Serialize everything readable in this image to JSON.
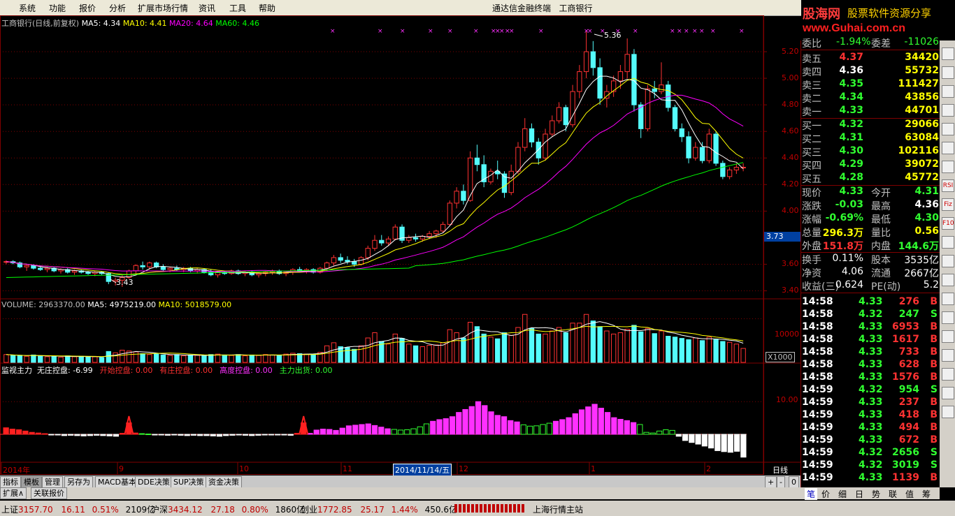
{
  "menu": [
    "系统",
    "功能",
    "报价",
    "分析",
    "扩展市场行情",
    "资讯",
    "工具",
    "帮助"
  ],
  "app_title": "通达信金融终端",
  "stock_name_title": "工商银行",
  "logo": {
    "name": "股海网",
    "slogan": "股票软件资源分享",
    "url": "www.Guhai.com.cn"
  },
  "main_legend": {
    "title": "工商银行(日线,前复权)",
    "ma5": "MA5: 4.34",
    "ma10": "MA10: 4.41",
    "ma20": "MA20: 4.64",
    "ma60": "MA60: 4.46"
  },
  "price_axis": {
    "ticks": [
      "5.20",
      "5.00",
      "4.80",
      "4.60",
      "4.40",
      "4.20",
      "4.00",
      "3.73",
      "3.60",
      "3.40"
    ],
    "current": "3.73"
  },
  "annotations": {
    "high": "5.36",
    "low": "3.43"
  },
  "volume_legend": {
    "volume": "VOLUME: 2963370.00",
    "ma5": "MA5: 4975219.00",
    "ma10": "MA10: 5018579.00",
    "axis_tick": "10000",
    "unit": "X1000"
  },
  "indicator_legend": {
    "name": "监视主力",
    "items": [
      {
        "label": "无庄控盘: -6.99",
        "color": "#ffffff"
      },
      {
        "label": "开始控盘: 0.00",
        "color": "#ff3030"
      },
      {
        "label": "有庄控盘: 0.00",
        "color": "#ff3030"
      },
      {
        "label": "高度控盘: 0.00",
        "color": "#ff30ff"
      },
      {
        "label": "主力出货: 0.00",
        "color": "#30ff30"
      }
    ],
    "axis_tick": "10.00"
  },
  "time_axis": {
    "labels": [
      "2014年",
      "9",
      "10",
      "11",
      "2014/11/14/五",
      "12",
      "1",
      "2"
    ],
    "period": "日线"
  },
  "tabs": [
    "指标",
    "模板",
    "管理",
    "另存为",
    "MACD基本",
    "DDE决策",
    "SUP决策",
    "资金决策"
  ],
  "sub_tabs": [
    "扩展∧",
    "关联报价"
  ],
  "zoom_controls": [
    "+",
    "-",
    "0"
  ],
  "quote_panel": {
    "ratio": {
      "label": "委比",
      "value": "-1.94%",
      "diff_label": "委差",
      "diff": "-11026"
    },
    "asks": [
      {
        "label": "卖五",
        "price": "4.37",
        "vol": "34420"
      },
      {
        "label": "卖四",
        "price": "4.36",
        "vol": "55732"
      },
      {
        "label": "卖三",
        "price": "4.35",
        "vol": "111427"
      },
      {
        "label": "卖二",
        "price": "4.34",
        "vol": "43856"
      },
      {
        "label": "卖一",
        "price": "4.33",
        "vol": "44701"
      }
    ],
    "bids": [
      {
        "label": "买一",
        "price": "4.32",
        "vol": "29066"
      },
      {
        "label": "买二",
        "price": "4.31",
        "vol": "63084"
      },
      {
        "label": "买三",
        "price": "4.30",
        "vol": "102116"
      },
      {
        "label": "买四",
        "price": "4.29",
        "vol": "39072"
      },
      {
        "label": "买五",
        "price": "4.28",
        "vol": "45772"
      }
    ],
    "stats": [
      {
        "l1": "现价",
        "v1": "4.33",
        "l2": "今开",
        "v2": "4.31"
      },
      {
        "l1": "涨跌",
        "v1": "-0.03",
        "l2": "最高",
        "v2": "4.36"
      },
      {
        "l1": "涨幅",
        "v1": "-0.69%",
        "l2": "最低",
        "v2": "4.30"
      },
      {
        "l1": "总量",
        "v1": "296.3万",
        "l2": "量比",
        "v2": "0.56"
      },
      {
        "l1": "外盘",
        "v1": "151.8万",
        "l2": "内盘",
        "v2": "144.6万"
      }
    ],
    "fundamentals": [
      {
        "l1": "换手",
        "v1": "0.11%",
        "l2": "股本",
        "v2": "3535亿"
      },
      {
        "l1": "净资",
        "v1": "4.06",
        "l2": "流通",
        "v2": "2667亿"
      },
      {
        "l1": "收益(三)",
        "v1": "0.624",
        "l2": "PE(动)",
        "v2": "5.2"
      }
    ],
    "ticks": [
      {
        "t": "14:58",
        "p": "4.33",
        "v": "276",
        "s": "B"
      },
      {
        "t": "14:58",
        "p": "4.32",
        "v": "247",
        "s": "S"
      },
      {
        "t": "14:58",
        "p": "4.33",
        "v": "6953",
        "s": "B"
      },
      {
        "t": "14:58",
        "p": "4.33",
        "v": "1617",
        "s": "B"
      },
      {
        "t": "14:58",
        "p": "4.33",
        "v": "733",
        "s": "B"
      },
      {
        "t": "14:58",
        "p": "4.33",
        "v": "628",
        "s": "B"
      },
      {
        "t": "14:58",
        "p": "4.33",
        "v": "1576",
        "s": "B"
      },
      {
        "t": "14:59",
        "p": "4.32",
        "v": "954",
        "s": "S"
      },
      {
        "t": "14:59",
        "p": "4.33",
        "v": "237",
        "s": "B"
      },
      {
        "t": "14:59",
        "p": "4.33",
        "v": "418",
        "s": "B"
      },
      {
        "t": "14:59",
        "p": "4.33",
        "v": "494",
        "s": "B"
      },
      {
        "t": "14:59",
        "p": "4.33",
        "v": "672",
        "s": "B"
      },
      {
        "t": "14:59",
        "p": "4.32",
        "v": "2656",
        "s": "S"
      },
      {
        "t": "14:59",
        "p": "4.32",
        "v": "3019",
        "s": "S"
      },
      {
        "t": "14:59",
        "p": "4.33",
        "v": "1139",
        "s": "B"
      }
    ],
    "bottom_tabs": [
      "笔",
      "价",
      "细",
      "日",
      "势",
      "联",
      "值",
      "筹"
    ]
  },
  "status": {
    "sh": {
      "label": "上证",
      "value": "3157.70",
      "chg": "16.11",
      "pct": "0.51%",
      "amt": "2109亿"
    },
    "sz": {
      "label": "沪深",
      "value": "3434.12",
      "chg": "27.18",
      "pct": "0.80%",
      "amt": "1860亿"
    },
    "cy": {
      "label": "创业",
      "value": "1772.85",
      "chg": "25.17",
      "pct": "1.44%",
      "amt": "450.6亿"
    },
    "server": "上海行情主站"
  },
  "toolbar_icons": [
    "RSI",
    "Fiz",
    "F10"
  ],
  "colors": {
    "up": "#ff3232",
    "down": "#54fcfc",
    "ma5": "#ffffff",
    "ma10": "#ffff00",
    "ma20": "#ff00ff",
    "ma60": "#00ff00",
    "grid": "#800000"
  },
  "chart_data": {
    "type": "candlestick",
    "candles": [
      [
        3.62,
        3.63,
        3.6,
        3.62
      ],
      [
        3.62,
        3.63,
        3.6,
        3.61
      ],
      [
        3.61,
        3.62,
        3.57,
        3.58
      ],
      [
        3.58,
        3.6,
        3.55,
        3.59
      ],
      [
        3.59,
        3.6,
        3.56,
        3.57
      ],
      [
        3.57,
        3.59,
        3.55,
        3.56
      ],
      [
        3.56,
        3.58,
        3.54,
        3.57
      ],
      [
        3.57,
        3.58,
        3.54,
        3.55
      ],
      [
        3.55,
        3.57,
        3.53,
        3.56
      ],
      [
        3.56,
        3.57,
        3.53,
        3.54
      ],
      [
        3.54,
        3.56,
        3.52,
        3.55
      ],
      [
        3.55,
        3.56,
        3.53,
        3.54
      ],
      [
        3.54,
        3.55,
        3.52,
        3.53
      ],
      [
        3.53,
        3.55,
        3.51,
        3.54
      ],
      [
        3.54,
        3.55,
        3.52,
        3.53
      ],
      [
        3.53,
        3.54,
        3.45,
        3.47
      ],
      [
        3.47,
        3.5,
        3.44,
        3.48
      ],
      [
        3.48,
        3.52,
        3.43,
        3.5
      ],
      [
        3.5,
        3.56,
        3.49,
        3.55
      ],
      [
        3.55,
        3.6,
        3.53,
        3.59
      ],
      [
        3.59,
        3.62,
        3.56,
        3.58
      ],
      [
        3.58,
        3.62,
        3.56,
        3.61
      ],
      [
        3.61,
        3.62,
        3.57,
        3.58
      ],
      [
        3.58,
        3.6,
        3.55,
        3.56
      ],
      [
        3.56,
        3.58,
        3.54,
        3.57
      ],
      [
        3.57,
        3.59,
        3.55,
        3.56
      ],
      [
        3.56,
        3.58,
        3.54,
        3.57
      ],
      [
        3.57,
        3.58,
        3.54,
        3.55
      ],
      [
        3.55,
        3.57,
        3.53,
        3.56
      ],
      [
        3.56,
        3.57,
        3.53,
        3.54
      ],
      [
        3.54,
        3.56,
        3.51,
        3.52
      ],
      [
        3.52,
        3.55,
        3.5,
        3.54
      ],
      [
        3.54,
        3.55,
        3.52,
        3.53
      ],
      [
        3.53,
        3.56,
        3.52,
        3.55
      ],
      [
        3.55,
        3.56,
        3.52,
        3.53
      ],
      [
        3.53,
        3.55,
        3.51,
        3.54
      ],
      [
        3.54,
        3.55,
        3.51,
        3.52
      ],
      [
        3.52,
        3.54,
        3.5,
        3.53
      ],
      [
        3.53,
        3.55,
        3.51,
        3.54
      ],
      [
        3.54,
        3.56,
        3.52,
        3.55
      ],
      [
        3.55,
        3.56,
        3.52,
        3.53
      ],
      [
        3.53,
        3.55,
        3.51,
        3.54
      ],
      [
        3.54,
        3.57,
        3.52,
        3.56
      ],
      [
        3.56,
        3.58,
        3.54,
        3.55
      ],
      [
        3.55,
        3.57,
        3.53,
        3.56
      ],
      [
        3.56,
        3.57,
        3.53,
        3.54
      ],
      [
        3.54,
        3.58,
        3.53,
        3.57
      ],
      [
        3.57,
        3.62,
        3.55,
        3.61
      ],
      [
        3.61,
        3.67,
        3.59,
        3.65
      ],
      [
        3.65,
        3.68,
        3.61,
        3.63
      ],
      [
        3.63,
        3.66,
        3.6,
        3.62
      ],
      [
        3.62,
        3.64,
        3.58,
        3.6
      ],
      [
        3.6,
        3.66,
        3.59,
        3.65
      ],
      [
        3.65,
        3.74,
        3.63,
        3.72
      ],
      [
        3.72,
        3.82,
        3.7,
        3.78
      ],
      [
        3.78,
        3.82,
        3.74,
        3.76
      ],
      [
        3.76,
        3.81,
        3.74,
        3.79
      ],
      [
        3.79,
        3.9,
        3.78,
        3.88
      ],
      [
        3.88,
        3.9,
        3.76,
        3.78
      ],
      [
        3.78,
        3.82,
        3.76,
        3.8
      ],
      [
        3.8,
        3.83,
        3.77,
        3.79
      ],
      [
        3.79,
        3.82,
        3.77,
        3.81
      ],
      [
        3.81,
        3.85,
        3.79,
        3.83
      ],
      [
        3.83,
        3.86,
        3.8,
        3.85
      ],
      [
        3.85,
        3.92,
        3.84,
        3.9
      ],
      [
        3.9,
        4.08,
        3.89,
        4.06
      ],
      [
        4.06,
        4.18,
        4.02,
        4.15
      ],
      [
        4.15,
        4.2,
        4.05,
        4.08
      ],
      [
        4.08,
        4.45,
        4.07,
        4.4
      ],
      [
        4.4,
        4.5,
        4.3,
        4.35
      ],
      [
        4.35,
        4.42,
        4.18,
        4.22
      ],
      [
        4.22,
        4.32,
        4.2,
        4.3
      ],
      [
        4.3,
        4.38,
        4.24,
        4.28
      ],
      [
        4.28,
        4.3,
        4.1,
        4.14
      ],
      [
        4.14,
        4.35,
        4.12,
        4.3
      ],
      [
        4.3,
        4.52,
        4.28,
        4.48
      ],
      [
        4.48,
        4.7,
        4.45,
        4.62
      ],
      [
        4.62,
        4.66,
        4.48,
        4.52
      ],
      [
        4.52,
        4.55,
        4.35,
        4.4
      ],
      [
        4.4,
        4.62,
        4.38,
        4.58
      ],
      [
        4.58,
        4.72,
        4.56,
        4.68
      ],
      [
        4.68,
        4.82,
        4.66,
        4.78
      ],
      [
        4.78,
        4.8,
        4.6,
        4.65
      ],
      [
        4.65,
        4.95,
        4.63,
        4.9
      ],
      [
        4.9,
        5.1,
        4.85,
        5.05
      ],
      [
        5.05,
        5.36,
        5.0,
        5.2
      ],
      [
        5.2,
        5.28,
        5.02,
        5.08
      ],
      [
        5.08,
        5.15,
        4.8,
        4.85
      ],
      [
        4.85,
        4.95,
        4.78,
        4.9
      ],
      [
        4.9,
        5.02,
        4.86,
        4.98
      ],
      [
        4.98,
        5.1,
        4.92,
        5.05
      ],
      [
        5.05,
        5.3,
        5.0,
        5.18
      ],
      [
        5.18,
        5.22,
        4.75,
        4.8
      ],
      [
        4.8,
        4.82,
        4.55,
        4.62
      ],
      [
        4.62,
        4.95,
        4.6,
        4.92
      ],
      [
        4.92,
        4.98,
        4.85,
        4.9
      ],
      [
        4.9,
        5.12,
        4.88,
        4.95
      ],
      [
        4.95,
        4.98,
        4.75,
        4.78
      ],
      [
        4.78,
        4.8,
        4.6,
        4.62
      ],
      [
        4.62,
        4.66,
        4.52,
        4.56
      ],
      [
        4.56,
        4.6,
        4.36,
        4.4
      ],
      [
        4.4,
        4.52,
        4.38,
        4.48
      ],
      [
        4.48,
        4.52,
        4.36,
        4.38
      ],
      [
        4.38,
        4.62,
        4.36,
        4.58
      ],
      [
        4.58,
        4.6,
        4.34,
        4.36
      ],
      [
        4.36,
        4.38,
        4.24,
        4.26
      ],
      [
        4.26,
        4.33,
        4.24,
        4.31
      ],
      [
        4.31,
        4.36,
        4.28,
        4.33
      ],
      [
        4.33,
        4.36,
        4.3,
        4.33
      ]
    ],
    "volumes": [
      1800,
      1600,
      1500,
      1400,
      1700,
      1500,
      1300,
      1400,
      1200,
      1500,
      1300,
      1400,
      1200,
      1300,
      1100,
      2500,
      2200,
      2800,
      2600,
      2400,
      2000,
      1800,
      1900,
      1700,
      1600,
      1800,
      1500,
      1700,
      1600,
      1500,
      1800,
      1900,
      1700,
      1600,
      1800,
      1500,
      1700,
      1600,
      1800,
      1700,
      1600,
      1900,
      2100,
      2000,
      1900,
      1800,
      2300,
      3800,
      4500,
      3600,
      3400,
      3000,
      3800,
      5600,
      6800,
      4800,
      4200,
      6500,
      5500,
      4200,
      3800,
      3600,
      3900,
      4000,
      4500,
      7500,
      6800,
      5600,
      9200,
      8200,
      6500,
      5800,
      5400,
      6800,
      6200,
      8000,
      11000,
      7800,
      6500,
      6500,
      7200,
      8000,
      6800,
      9000,
      9000,
      11000,
      9500,
      8200,
      7200,
      6500,
      6800,
      7600,
      8500,
      7000,
      7800,
      6600,
      7200,
      6000,
      5800,
      5500,
      5200,
      5600,
      5000,
      5800,
      5200,
      4800,
      4600,
      4200,
      3200
    ],
    "indicator": [
      2.0,
      1.6,
      1.4,
      1.0,
      0.6,
      0.4,
      0.2,
      -0.1,
      -0.2,
      -0.4,
      -0.3,
      -0.4,
      -0.5,
      -0.4,
      -0.3,
      -0.4,
      -0.5,
      -0.6,
      0.3,
      3.5,
      0.4,
      0.2,
      0.1,
      -0.1,
      -0.2,
      -0.3,
      -0.2,
      -0.3,
      -0.4,
      -0.3,
      -0.4,
      -0.4,
      -0.5,
      -0.6,
      -0.4,
      -0.3,
      -0.2,
      -0.3,
      -0.4,
      -0.3,
      -0.2,
      -0.1,
      -0.1,
      -0.2,
      -0.3,
      0.3,
      3.5,
      0.3,
      1.3,
      1.6,
      1.5,
      1.2,
      1.9,
      2.6,
      2.8,
      3.0,
      3.2,
      2.7,
      2.2,
      1.7,
      1.5,
      1.3,
      1.4,
      1.7,
      2.3,
      3.2,
      4.0,
      4.5,
      4.8,
      5.4,
      6.7,
      7.6,
      8.5,
      10.0,
      8.8,
      6.9,
      5.8,
      5.4,
      4.2,
      3.8,
      2.9,
      2.5,
      2.6,
      3.0,
      3.4,
      4.0,
      4.5,
      5.1,
      6.3,
      7.5,
      8.4,
      9.2,
      8.0,
      6.7,
      5.1,
      4.6,
      4.2,
      3.6,
      3.0,
      0.6,
      0.4,
      1.0,
      1.4,
      1.2,
      -0.6,
      -1.9,
      -2.5,
      -3.0,
      -3.6,
      -4.2,
      -5.0,
      -5.3,
      -5.5,
      -5.2,
      -6.99
    ]
  }
}
